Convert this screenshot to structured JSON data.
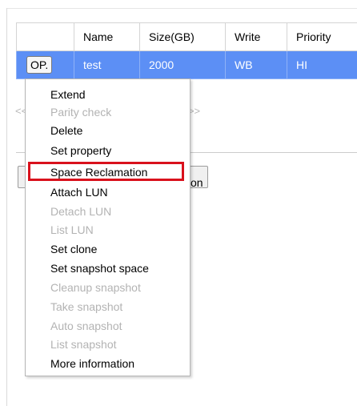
{
  "table": {
    "headers": [
      "",
      "Name",
      "Size(GB)",
      "Write",
      "Priority"
    ],
    "row": {
      "op_label": "OP.",
      "name": "test",
      "size": "2000",
      "write": "WB",
      "priority": "HI"
    }
  },
  "pager": {
    "left": "<<",
    "right": "ast >>"
  },
  "background_button": {
    "label": "on"
  },
  "menu": {
    "items": [
      {
        "label": "Extend",
        "enabled": true
      },
      {
        "label": "Parity check",
        "enabled": false
      },
      {
        "label": "Delete",
        "enabled": true
      },
      {
        "label": "Set property",
        "enabled": true
      },
      {
        "label": "Space Reclamation",
        "enabled": true,
        "highlighted": true
      },
      {
        "label": "Attach LUN",
        "enabled": true
      },
      {
        "label": "Detach LUN",
        "enabled": false
      },
      {
        "label": "List LUN",
        "enabled": false
      },
      {
        "label": "Set clone",
        "enabled": true
      },
      {
        "label": "Set snapshot space",
        "enabled": true
      },
      {
        "label": "Cleanup snapshot",
        "enabled": false
      },
      {
        "label": "Take snapshot",
        "enabled": false
      },
      {
        "label": "Auto snapshot",
        "enabled": false
      },
      {
        "label": "List snapshot",
        "enabled": false
      },
      {
        "label": "More information",
        "enabled": true
      }
    ]
  },
  "colors": {
    "row_selected": "#5c8ff5",
    "highlight_border": "#d9111c",
    "disabled_text": "#b3b3b3"
  }
}
